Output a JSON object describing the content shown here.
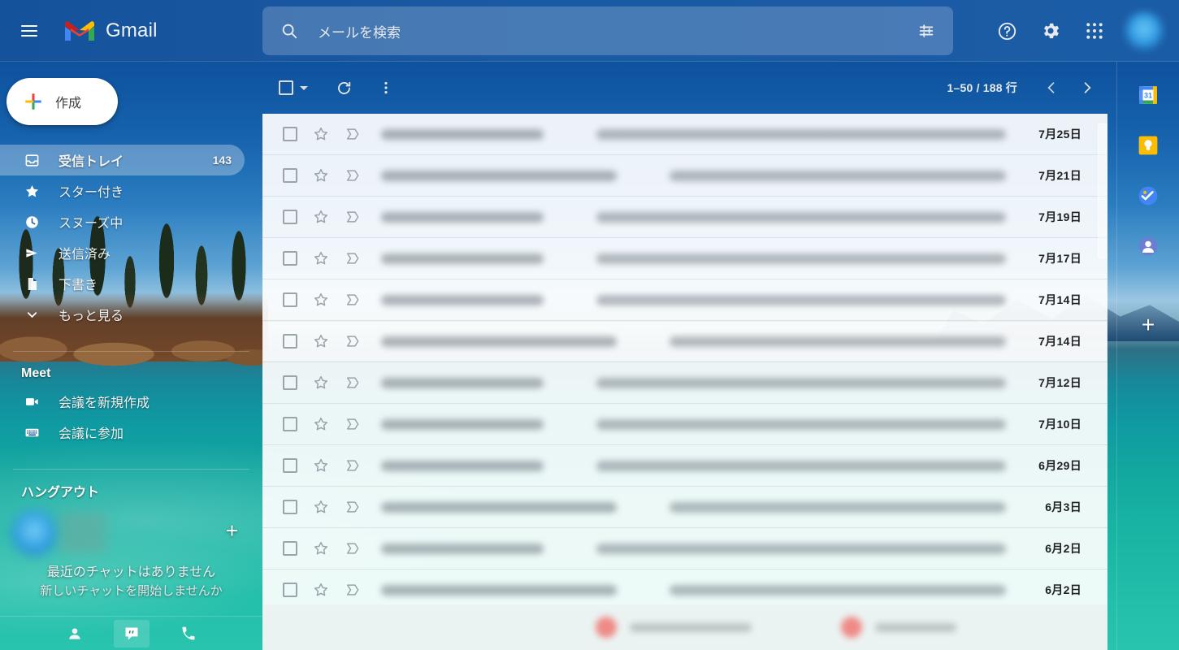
{
  "app": {
    "name": "Gmail",
    "menu_label": "menu",
    "theme_color": "#15529c"
  },
  "search": {
    "placeholder": "メールを検索",
    "value": "",
    "icon": "search-icon",
    "options_icon": "search-options-icon"
  },
  "header": {
    "help_label": "サポート",
    "settings_label": "設定",
    "apps_label": "Google アプリ",
    "account_label": "Google アカウント"
  },
  "sidebar": {
    "compose_label": "作成",
    "items": [
      {
        "label": "受信トレイ",
        "icon": "inbox-icon",
        "count": "143",
        "active": true
      },
      {
        "label": "スター付き",
        "icon": "star-icon",
        "count": "",
        "active": false
      },
      {
        "label": "スヌーズ中",
        "icon": "clock-icon",
        "count": "",
        "active": false
      },
      {
        "label": "送信済み",
        "icon": "send-icon",
        "count": "",
        "active": false
      },
      {
        "label": "下書き",
        "icon": "draft-icon",
        "count": "",
        "active": false
      },
      {
        "label": "もっと見る",
        "icon": "chevron-down-icon",
        "count": "",
        "active": false
      }
    ],
    "meet": {
      "title": "Meet",
      "items": [
        {
          "label": "会議を新規作成",
          "icon": "video-camera-icon"
        },
        {
          "label": "会議に参加",
          "icon": "keyboard-icon"
        }
      ]
    },
    "hangouts": {
      "title": "ハングアウト",
      "add_label": "+",
      "empty_line1": "最近のチャットはありません",
      "empty_line2": "新しいチャットを開始しませんか",
      "tabs": [
        {
          "icon": "person-icon",
          "selected": false
        },
        {
          "icon": "hangouts-quote-icon",
          "selected": true
        },
        {
          "icon": "phone-icon",
          "selected": false
        }
      ]
    }
  },
  "toolbar": {
    "select_all_label": "すべて選択",
    "refresh_label": "更新",
    "more_label": "その他",
    "pager_text": "1–50 / 188 行",
    "prev_label": "新しい",
    "next_label": "古い"
  },
  "mail_list": {
    "rows": [
      {
        "sender": "",
        "subject": "",
        "date": "7月25日",
        "wide": false,
        "hovered": false
      },
      {
        "sender": "",
        "subject": "",
        "date": "7月21日",
        "wide": true,
        "hovered": false
      },
      {
        "sender": "",
        "subject": "",
        "date": "7月19日",
        "wide": false,
        "hovered": false
      },
      {
        "sender": "",
        "subject": "",
        "date": "7月17日",
        "wide": false,
        "hovered": false
      },
      {
        "sender": "",
        "subject": "",
        "date": "7月14日",
        "wide": false,
        "hovered": false
      },
      {
        "sender": "",
        "subject": "",
        "date": "7月14日",
        "wide": true,
        "hovered": true
      },
      {
        "sender": "",
        "subject": "",
        "date": "7月12日",
        "wide": false,
        "hovered": false
      },
      {
        "sender": "",
        "subject": "",
        "date": "7月10日",
        "wide": false,
        "hovered": false
      },
      {
        "sender": "",
        "subject": "",
        "date": "6月29日",
        "wide": false,
        "hovered": false
      },
      {
        "sender": "",
        "subject": "",
        "date": "6月3日",
        "wide": true,
        "hovered": false
      },
      {
        "sender": "",
        "subject": "",
        "date": "6月2日",
        "wide": false,
        "hovered": false
      },
      {
        "sender": "",
        "subject": "",
        "date": "6月2日",
        "wide": true,
        "hovered": false
      }
    ],
    "note": "送信者名と件名はぼかし処理されています"
  },
  "right_panel": {
    "addons": [
      {
        "name": "calendar-icon",
        "label": "カレンダー",
        "badge": "31",
        "color": "#1a73e8"
      },
      {
        "name": "keep-icon",
        "label": "Keep",
        "color": "#fbbc04"
      },
      {
        "name": "tasks-icon",
        "label": "ToDo リスト",
        "color": "#1a73e8"
      },
      {
        "name": "contacts-icon",
        "label": "連絡先",
        "color": "#5c6bc0"
      }
    ],
    "add_label": "+"
  }
}
